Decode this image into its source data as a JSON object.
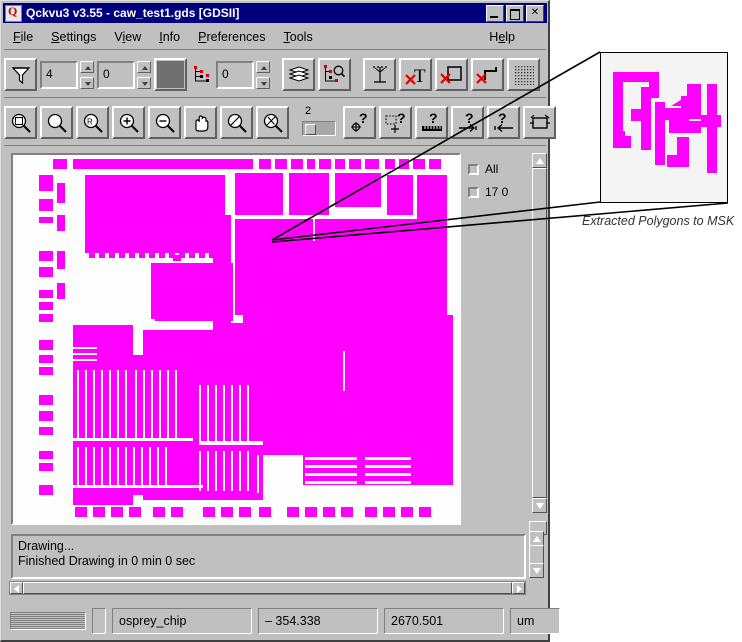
{
  "window": {
    "title": "Qckvu3 v3.55 - caw_test1.gds [GDSII]",
    "icon": "app-icon",
    "buttons": {
      "minimize": "_",
      "maximize": "□",
      "close": "✕"
    }
  },
  "menubar": {
    "items": [
      {
        "label": "File",
        "mnemonic": "F"
      },
      {
        "label": "Settings",
        "mnemonic": "S"
      },
      {
        "label": "View",
        "mnemonic": "V"
      },
      {
        "label": "Info",
        "mnemonic": "I"
      },
      {
        "label": "Preferences",
        "mnemonic": "P"
      },
      {
        "label": "Tools",
        "mnemonic": "T"
      }
    ],
    "help": {
      "label": "Help",
      "mnemonic": "H"
    }
  },
  "toolbar1": {
    "items": [
      {
        "name": "filter-funnel-button",
        "kind": "button",
        "icon": "funnel-icon"
      },
      {
        "name": "depth-field",
        "kind": "field",
        "value": "4"
      },
      {
        "name": "depth-spinner",
        "kind": "spinner"
      },
      {
        "name": "level-field",
        "kind": "field",
        "value": "0"
      },
      {
        "name": "level-spinner",
        "kind": "spinner"
      },
      {
        "name": "fill-color-swatch",
        "kind": "swatch",
        "color": "#707070"
      },
      {
        "name": "hierarchy-tree-icon",
        "kind": "icon",
        "icon": "hierarchy-tree-icon"
      },
      {
        "name": "hierarchy-field",
        "kind": "field",
        "value": "0"
      },
      {
        "name": "hierarchy-spinner",
        "kind": "spinner"
      },
      {
        "name": "layers-stack-button",
        "kind": "button",
        "icon": "layers-stack-icon"
      },
      {
        "name": "find-in-hierarchy-button",
        "kind": "button",
        "icon": "hierarchy-search-icon"
      },
      {
        "name": "text-tool-button",
        "kind": "button",
        "icon": "text-anchor-icon"
      },
      {
        "name": "hide-text-button",
        "kind": "button",
        "icon": "no-text-icon"
      },
      {
        "name": "hide-box-button",
        "kind": "button",
        "icon": "no-box-icon"
      },
      {
        "name": "hide-path-button",
        "kind": "button",
        "icon": "no-path-icon"
      },
      {
        "name": "dot-fill-button",
        "kind": "button",
        "icon": "dot-grid-icon"
      }
    ]
  },
  "toolbar2": {
    "items": [
      {
        "name": "zoom-window-button",
        "kind": "button",
        "icon": "zoom-window-icon"
      },
      {
        "name": "zoom-all-button",
        "kind": "button",
        "icon": "zoom-all-icon"
      },
      {
        "name": "zoom-previous-button",
        "kind": "button",
        "icon": "zoom-previous-icon"
      },
      {
        "name": "zoom-in-button",
        "kind": "button",
        "icon": "zoom-in-icon"
      },
      {
        "name": "zoom-out-button",
        "kind": "button",
        "icon": "zoom-out-icon"
      },
      {
        "name": "pan-hand-button",
        "kind": "button",
        "icon": "pan-hand-icon"
      },
      {
        "name": "zoom-select-button",
        "kind": "button",
        "icon": "zoom-slash-icon"
      },
      {
        "name": "zoom-reset-button",
        "kind": "button",
        "icon": "zoom-reset-icon"
      },
      {
        "name": "detail-level-slider",
        "kind": "slider",
        "value": "2"
      },
      {
        "name": "query-point-button",
        "kind": "button",
        "icon": "query-point-icon"
      },
      {
        "name": "query-area-button",
        "kind": "button",
        "icon": "query-area-icon"
      },
      {
        "name": "measure-button",
        "kind": "button",
        "icon": "query-ruler-icon"
      },
      {
        "name": "query-next-button",
        "kind": "button",
        "icon": "query-next-icon"
      },
      {
        "name": "query-prev-button",
        "kind": "button",
        "icon": "query-prev-icon"
      },
      {
        "name": "cycle-view-button",
        "kind": "button",
        "icon": "cycle-view-icon"
      }
    ]
  },
  "layer_panel": {
    "rows": [
      {
        "label": "All",
        "checked": false
      },
      {
        "label": "17 0",
        "checked": false
      }
    ]
  },
  "messages": {
    "line1": "Drawing...",
    "line2": "Finished Drawing in 0 min 0 sec"
  },
  "statusbar": {
    "cell": "osprey_chip",
    "x": "– 354.338",
    "y": "2670.501",
    "unit": "um"
  },
  "annotation": {
    "caption": "Extracted Polygons to MSK",
    "layer_color": "#ff00ff"
  },
  "colors": {
    "layer_magenta": "#ff00ff",
    "canvas_background": "#fdfdfd",
    "window_face": "#c0c0c0",
    "titlebar": "#00007f"
  }
}
